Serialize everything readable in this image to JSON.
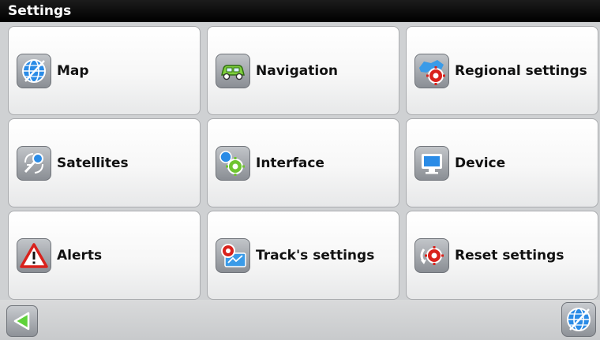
{
  "header": {
    "title": "Settings"
  },
  "tiles": [
    {
      "label": "Map",
      "icon": "globe-icon"
    },
    {
      "label": "Navigation",
      "icon": "car-icon"
    },
    {
      "label": "Regional settings",
      "icon": "regional-gear-icon"
    },
    {
      "label": "Satellites",
      "icon": "satellite-icon"
    },
    {
      "label": "Interface",
      "icon": "interface-gear-icon"
    },
    {
      "label": "Device",
      "icon": "monitor-icon"
    },
    {
      "label": "Alerts",
      "icon": "warning-icon"
    },
    {
      "label": "Track's settings",
      "icon": "track-gear-icon"
    },
    {
      "label": "Reset settings",
      "icon": "reset-gear-icon"
    }
  ],
  "footer": {
    "back_icon": "back-arrow-icon",
    "map_icon": "globe-icon"
  },
  "colors": {
    "title_bar": "#000000",
    "accent_blue": "#2a8be6",
    "back_arrow": "#5fd23a",
    "alert_red": "#d9221c"
  }
}
